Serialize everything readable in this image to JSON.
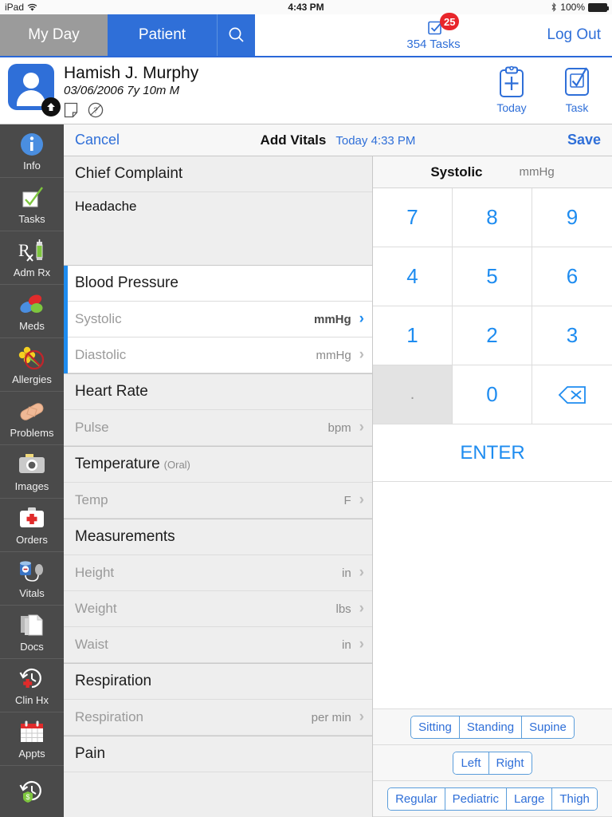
{
  "status_bar": {
    "device": "iPad",
    "wifi_icon": "wifi-icon",
    "time": "4:43 PM",
    "bluetooth_icon": "bluetooth-icon",
    "battery_percent": "100%"
  },
  "tab_bar": {
    "tabs": [
      {
        "label": "My Day",
        "selected": false
      },
      {
        "label": "Patient",
        "selected": true
      }
    ],
    "search_icon": "search-icon",
    "tasks": {
      "badge": "25",
      "label": "354 Tasks",
      "icon": "checkbox-icon"
    },
    "logout_label": "Log Out"
  },
  "patient": {
    "name": "Hamish J. Murphy",
    "demographics": "03/06/2006 7y 10m M",
    "avatar_icon": "person-avatar",
    "note_icon": "note-icon",
    "help_icon": "question-circle-icon",
    "actions": [
      {
        "label": "Today",
        "icon": "clipboard-plus-icon"
      },
      {
        "label": "Task",
        "icon": "checkbox-check-icon"
      }
    ]
  },
  "sidebar": {
    "items": [
      {
        "label": "Info",
        "icon": "info-circle-icon"
      },
      {
        "label": "Tasks",
        "icon": "checkmark-box-icon"
      },
      {
        "label": "Adm Rx",
        "icon": "rx-syringe-icon"
      },
      {
        "label": "Meds",
        "icon": "pills-icon"
      },
      {
        "label": "Allergies",
        "icon": "flower-no-icon"
      },
      {
        "label": "Problems",
        "icon": "bandage-icon"
      },
      {
        "label": "Images",
        "icon": "camera-icon"
      },
      {
        "label": "Orders",
        "icon": "first-aid-kit-icon"
      },
      {
        "label": "Vitals",
        "icon": "blood-pressure-cuff-icon"
      },
      {
        "label": "Docs",
        "icon": "documents-icon"
      },
      {
        "label": "Clin Hx",
        "icon": "clock-back-plus-icon"
      },
      {
        "label": "Appts",
        "icon": "calendar-icon"
      },
      {
        "label": "",
        "icon": "clock-back-dollar-icon"
      }
    ]
  },
  "toolbar": {
    "cancel_label": "Cancel",
    "title": "Add Vitals",
    "timestamp": "Today 4:33 PM",
    "save_label": "Save"
  },
  "form": {
    "sections": [
      {
        "title": "Chief Complaint",
        "subtitle": "",
        "active": false,
        "text_body": "Headache",
        "rows": []
      },
      {
        "title": "Blood Pressure",
        "subtitle": "",
        "active": true,
        "rows": [
          {
            "label": "Systolic",
            "value": "",
            "unit": "mmHg",
            "selected": true
          },
          {
            "label": "Diastolic",
            "value": "",
            "unit": "mmHg",
            "selected": false
          }
        ]
      },
      {
        "title": "Heart Rate",
        "subtitle": "",
        "active": false,
        "rows": [
          {
            "label": "Pulse",
            "value": "",
            "unit": "bpm",
            "selected": false
          }
        ]
      },
      {
        "title": "Temperature",
        "subtitle": "(Oral)",
        "active": false,
        "rows": [
          {
            "label": "Temp",
            "value": "",
            "unit": "F",
            "selected": false
          }
        ]
      },
      {
        "title": "Measurements",
        "subtitle": "",
        "active": false,
        "rows": [
          {
            "label": "Height",
            "value": "",
            "unit": "in",
            "selected": false
          },
          {
            "label": "Weight",
            "value": "",
            "unit": "lbs",
            "selected": false
          },
          {
            "label": "Waist",
            "value": "",
            "unit": "in",
            "selected": false
          }
        ]
      },
      {
        "title": "Respiration",
        "subtitle": "",
        "active": false,
        "rows": [
          {
            "label": "Respiration",
            "value": "",
            "unit": "per min",
            "selected": false
          }
        ]
      },
      {
        "title": "Pain",
        "subtitle": "",
        "active": false,
        "rows": []
      }
    ]
  },
  "keypad": {
    "field_title": "Systolic",
    "field_unit": "mmHg",
    "keys": [
      "7",
      "8",
      "9",
      "4",
      "5",
      "6",
      "1",
      "2",
      "3",
      ".",
      "0",
      "delete-icon"
    ],
    "decimal_key": ".",
    "backspace_icon": "backspace-icon",
    "enter_label": "ENTER",
    "option_groups": [
      {
        "name": "position",
        "options": [
          "Sitting",
          "Standing",
          "Supine"
        ]
      },
      {
        "name": "side",
        "options": [
          "Left",
          "Right"
        ]
      },
      {
        "name": "cuff-size",
        "options": [
          "Regular",
          "Pediatric",
          "Large",
          "Thigh"
        ]
      }
    ]
  },
  "colors": {
    "accent_blue": "#2f6fd8",
    "key_blue": "#1e8cf0",
    "badge_red": "#e8262b",
    "sidebar_bg": "#4a4a4a",
    "inactive_tab": "#9b9b9b"
  }
}
